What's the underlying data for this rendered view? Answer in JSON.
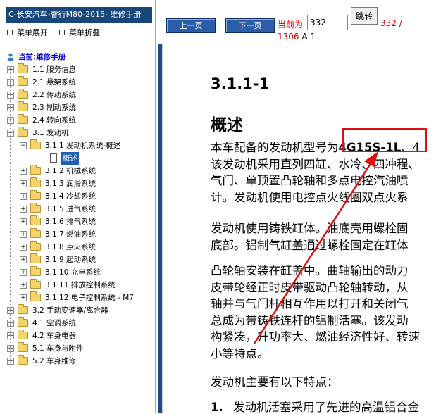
{
  "left_panel": {
    "title": "C-长安汽车-睿行M80-2015- 维修手册",
    "expand_all": "菜单展开",
    "collapse_all": "菜单折叠",
    "current_label": "当前:维修手册",
    "tree": [
      {
        "label": "1.1 服务信息",
        "level": 0,
        "expanded": false
      },
      {
        "label": "2.1 悬架系统",
        "level": 0,
        "expanded": false
      },
      {
        "label": "2.2 传动系统",
        "level": 0,
        "expanded": false
      },
      {
        "label": "2.3 制动系统",
        "level": 0,
        "expanded": false
      },
      {
        "label": "2.4 转向系统",
        "level": 0,
        "expanded": false
      },
      {
        "label": "3.1 发动机",
        "level": 0,
        "expanded": true
      },
      {
        "label": "3.1.1 发动机系统-概述",
        "level": 1,
        "expanded": true
      },
      {
        "label": "概述",
        "level": 2,
        "selected": true
      },
      {
        "label": "3.1.2 机械系统",
        "level": 1,
        "expanded": false
      },
      {
        "label": "3.1.3 润滑系统",
        "level": 1,
        "expanded": false
      },
      {
        "label": "3.1.4 冷却系统",
        "level": 1,
        "expanded": false
      },
      {
        "label": "3.1.5 进气系统",
        "level": 1,
        "expanded": false
      },
      {
        "label": "3.1.6 排气系统",
        "level": 1,
        "expanded": false
      },
      {
        "label": "3.1.7 燃油系统",
        "level": 1,
        "expanded": false
      },
      {
        "label": "3.1.8 点火系统",
        "level": 1,
        "expanded": false
      },
      {
        "label": "3.1.9 起动系统",
        "level": 1,
        "expanded": false
      },
      {
        "label": "3.1.10 充电系统",
        "level": 1,
        "expanded": false
      },
      {
        "label": "3.1.11 排放控制系统",
        "level": 1,
        "expanded": false
      },
      {
        "label": "3.1.12 电子控制系统 - M7",
        "level": 1,
        "expanded": false
      },
      {
        "label": "3.2 手动变速器/离合器",
        "level": 0,
        "expanded": false
      },
      {
        "label": "4.1 空调系统",
        "level": 0,
        "expanded": false
      },
      {
        "label": "4.2 车身电器",
        "level": 0,
        "expanded": false
      },
      {
        "label": "5.1 车身与附件",
        "level": 0,
        "expanded": false
      },
      {
        "label": "5.2 车身维修",
        "level": 0,
        "expanded": false
      }
    ]
  },
  "toolbar": {
    "prev_label": "上一页",
    "next_label": "下一页",
    "current_page_label": "当前为",
    "page_input_value": "332",
    "go_label": "跳转",
    "page_of": "332 /",
    "total_pages": "1306",
    "page_suffix": "A 1"
  },
  "document": {
    "section_title": "3.1.1-1",
    "subtitle": "概述",
    "p1": [
      {
        "pre": "本车配备的发动机型号为",
        "model": "4G15S-1L",
        "post": "、4"
      },
      {
        "text": "该发动机采用直列四缸、水冷、四冲程、"
      },
      {
        "text": "气门、单顶置凸轮轴和多点电控汽油喷"
      },
      {
        "text": "计。发动机使用电控点火线圈双点火系"
      }
    ],
    "p2": [
      {
        "text": "发动机使用铸铁缸体。油底壳用螺栓固"
      },
      {
        "text": "底部。铝制气缸盖通过螺栓固定在缸体"
      }
    ],
    "p3": [
      {
        "text": "凸轮轴安装在缸盖中。曲轴输出的动力"
      },
      {
        "text": "皮带轮经正时皮带驱动凸轮轴转动，从"
      },
      {
        "text": "轴并与气门杆相互作用以打开和关闭气"
      },
      {
        "text": "总成为带铸铁连杆的铝制活塞。该发动"
      },
      {
        "text": "构紧凑，升功率大、燃油经济性好、转速"
      },
      {
        "text": "小等特点。"
      }
    ],
    "p4": "发动机主要有以下特点：",
    "item1_num": "1.",
    "item1_text": "发动机活塞采用了先进的高温铝合金"
  },
  "annotation_color": "#e01010"
}
